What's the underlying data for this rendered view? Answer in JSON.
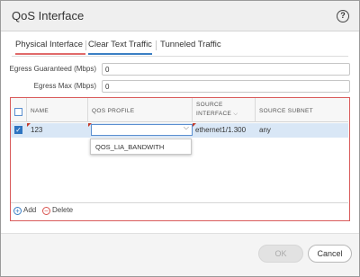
{
  "dialog": {
    "title": "QoS Interface",
    "help_icon": "?"
  },
  "tabs": [
    {
      "label": "Physical Interface"
    },
    {
      "label": "Clear Text Traffic"
    },
    {
      "label": "Tunneled Traffic"
    }
  ],
  "fields": {
    "egress_guaranteed": {
      "label": "Egress Guaranteed (Mbps)",
      "value": "0"
    },
    "egress_max": {
      "label": "Egress Max (Mbps)",
      "value": "0"
    }
  },
  "grid": {
    "columns": [
      "NAME",
      "QOS PROFILE",
      "SOURCE",
      "INTERFACE",
      "SOURCE SUBNET"
    ],
    "rows": [
      {
        "name": "123",
        "qos_profile": "",
        "source_interface": "ethernet1/1.300",
        "source_subnet": "any",
        "checked": "✓"
      }
    ],
    "dropdown_option": "QOS_LIA_BANDWITH",
    "add_label": "Add",
    "delete_label": "Delete"
  },
  "buttons": {
    "ok": "OK",
    "cancel": "Cancel"
  },
  "colors": {
    "accent": "#3b7fc4",
    "error": "#d95b5b",
    "selected_row": "#d9e7f6"
  },
  "icons": {
    "help": "help-icon",
    "add": "add-icon",
    "delete": "delete-icon",
    "check": "check-icon",
    "dropdown": "chevron-down-icon",
    "sort": "chevron-down-icon"
  }
}
